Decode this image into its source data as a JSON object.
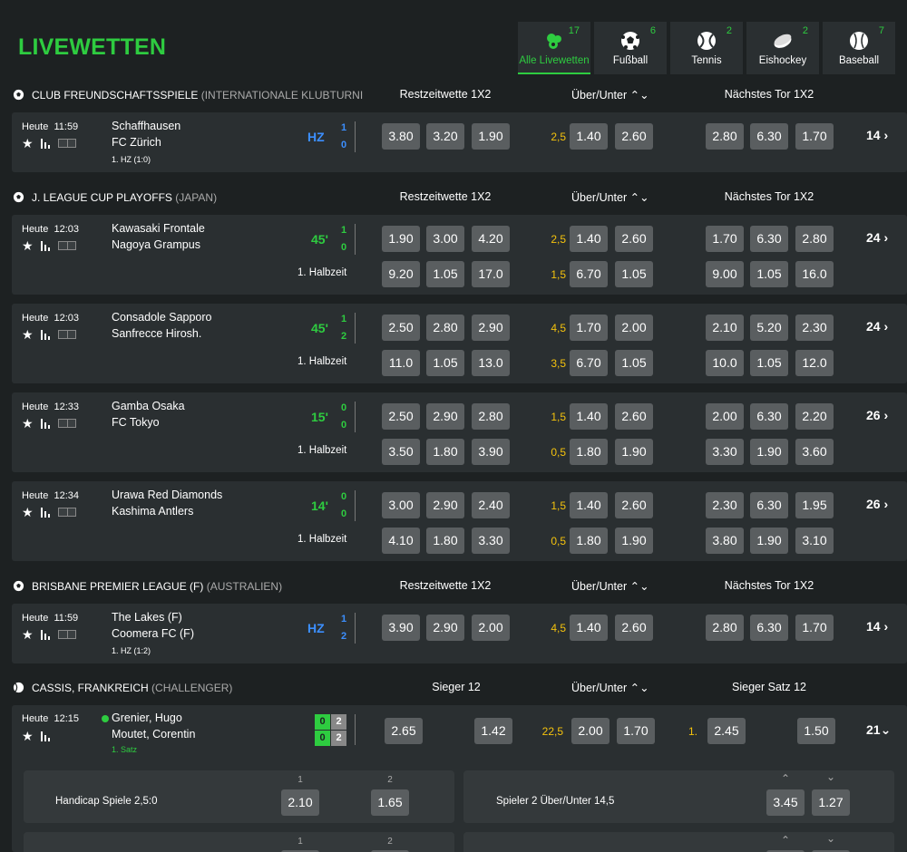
{
  "page": {
    "title": "LIVEWETTEN"
  },
  "sport_tabs": [
    {
      "label": "Alle Livewetten",
      "count": "17",
      "icon": "all-sports-icon",
      "active": true
    },
    {
      "label": "Fußball",
      "count": "6",
      "icon": "soccer-ball-icon"
    },
    {
      "label": "Tennis",
      "count": "2",
      "icon": "tennis-ball-icon"
    },
    {
      "label": "Eishockey",
      "count": "2",
      "icon": "hockey-puck-icon"
    },
    {
      "label": "Baseball",
      "count": "7",
      "icon": "baseball-icon"
    }
  ],
  "leagues": [
    {
      "name": "CLUB FREUNDSCHAFTSSPIELE",
      "sub": "(INTERNATIONALE KLUBTURNIER",
      "col1": "Restzeitwette 1X2",
      "col2": "Über/Unter",
      "col3": "Nächstes Tor 1X2"
    },
    {
      "name": "J. LEAGUE CUP PLAYOFFS",
      "sub": "(JAPAN)",
      "col1": "Restzeitwette 1X2",
      "col2": "Über/Unter",
      "col3": "Nächstes Tor 1X2"
    },
    {
      "name": "BRISBANE PREMIER LEAGUE (F)",
      "sub": "(AUSTRALIEN)",
      "col1": "Restzeitwette 1X2",
      "col2": "Über/Unter",
      "col3": "Nächstes Tor 1X2"
    },
    {
      "name": "CASSIS, FRANKREICH",
      "sub": "(CHALLENGER)",
      "col1": "Sieger 12",
      "col2": "Über/Unter",
      "col3": "Sieger Satz 12"
    }
  ],
  "matches": [
    {
      "date": "Heute",
      "time": "11:59",
      "home": "Schaffhausen",
      "away": "FC Zürich",
      "state": "HZ",
      "s1": "1",
      "s2": "0",
      "note": "1. HZ (1:0)",
      "r1": {
        "o": [
          "3.80",
          "3.20",
          "1.90"
        ],
        "h": "2,5",
        "ou": [
          "1.40",
          "2.60"
        ],
        "n": [
          "2.80",
          "6.30",
          "1.70"
        ]
      },
      "more": "14"
    },
    {
      "date": "Heute",
      "time": "12:03",
      "home": "Kawasaki Frontale",
      "away": "Nagoya Grampus",
      "state": "45'",
      "s1": "1",
      "s2": "0",
      "period": "1. Halbzeit",
      "r1": {
        "o": [
          "1.90",
          "3.00",
          "4.20"
        ],
        "h": "2,5",
        "ou": [
          "1.40",
          "2.60"
        ],
        "n": [
          "1.70",
          "6.30",
          "2.80"
        ]
      },
      "r2": {
        "o": [
          "9.20",
          "1.05",
          "17.0"
        ],
        "h": "1,5",
        "ou": [
          "6.70",
          "1.05"
        ],
        "n": [
          "9.00",
          "1.05",
          "16.0"
        ]
      },
      "more": "24"
    },
    {
      "date": "Heute",
      "time": "12:03",
      "home": "Consadole Sapporo",
      "away": "Sanfrecce Hirosh.",
      "state": "45'",
      "s1": "1",
      "s2": "2",
      "period": "1. Halbzeit",
      "r1": {
        "o": [
          "2.50",
          "2.80",
          "2.90"
        ],
        "h": "4,5",
        "ou": [
          "1.70",
          "2.00"
        ],
        "n": [
          "2.10",
          "5.20",
          "2.30"
        ]
      },
      "r2": {
        "o": [
          "11.0",
          "1.05",
          "13.0"
        ],
        "h": "3,5",
        "ou": [
          "6.70",
          "1.05"
        ],
        "n": [
          "10.0",
          "1.05",
          "12.0"
        ]
      },
      "more": "24"
    },
    {
      "date": "Heute",
      "time": "12:33",
      "home": "Gamba Osaka",
      "away": "FC Tokyo",
      "state": "15'",
      "s1": "0",
      "s2": "0",
      "period": "1. Halbzeit",
      "r1": {
        "o": [
          "2.50",
          "2.90",
          "2.80"
        ],
        "h": "1,5",
        "ou": [
          "1.40",
          "2.60"
        ],
        "n": [
          "2.00",
          "6.30",
          "2.20"
        ]
      },
      "r2": {
        "o": [
          "3.50",
          "1.80",
          "3.90"
        ],
        "h": "0,5",
        "ou": [
          "1.80",
          "1.90"
        ],
        "n": [
          "3.30",
          "1.90",
          "3.60"
        ]
      },
      "more": "26"
    },
    {
      "date": "Heute",
      "time": "12:34",
      "home": "Urawa Red Diamonds",
      "away": "Kashima Antlers",
      "state": "14'",
      "s1": "0",
      "s2": "0",
      "period": "1. Halbzeit",
      "r1": {
        "o": [
          "3.00",
          "2.90",
          "2.40"
        ],
        "h": "1,5",
        "ou": [
          "1.40",
          "2.60"
        ],
        "n": [
          "2.30",
          "6.30",
          "1.95"
        ]
      },
      "r2": {
        "o": [
          "4.10",
          "1.80",
          "3.30"
        ],
        "h": "0,5",
        "ou": [
          "1.80",
          "1.90"
        ],
        "n": [
          "3.80",
          "1.90",
          "3.10"
        ]
      },
      "more": "26"
    },
    {
      "date": "Heute",
      "time": "11:59",
      "home": "The Lakes (F)",
      "away": "Coomera FC (F)",
      "state": "HZ",
      "s1": "1",
      "s2": "2",
      "note": "1. HZ (1:2)",
      "r1": {
        "o": [
          "3.90",
          "2.90",
          "2.00"
        ],
        "h": "4,5",
        "ou": [
          "1.40",
          "2.60"
        ],
        "n": [
          "2.80",
          "6.30",
          "1.70"
        ]
      },
      "more": "14"
    }
  ],
  "tennis": {
    "date": "Heute",
    "time": "12:15",
    "home": "Grenier, Hugo",
    "away": "Moutet, Corentin",
    "note": "1. Satz",
    "sets": {
      "p1_set": "0",
      "p1_games": "2",
      "p2_set": "0",
      "p2_games": "2"
    },
    "winner": [
      "2.65",
      "1.42"
    ],
    "ou_line": "22,5",
    "ou": [
      "2.00",
      "1.70"
    ],
    "set_label": "1.",
    "set_winner": [
      "2.45",
      "1.50"
    ],
    "more": "21"
  },
  "subpanels": {
    "handicap": {
      "title": "Handicap Spiele 2,5:0",
      "col1": "1",
      "col2": "2",
      "odds": [
        "2.10",
        "1.65"
      ]
    },
    "spieler": {
      "title": "Spieler 2 Über/Unter 14,5",
      "odds": [
        "3.45",
        "1.27"
      ]
    },
    "next": {
      "col1": "1",
      "col2": "2"
    }
  }
}
